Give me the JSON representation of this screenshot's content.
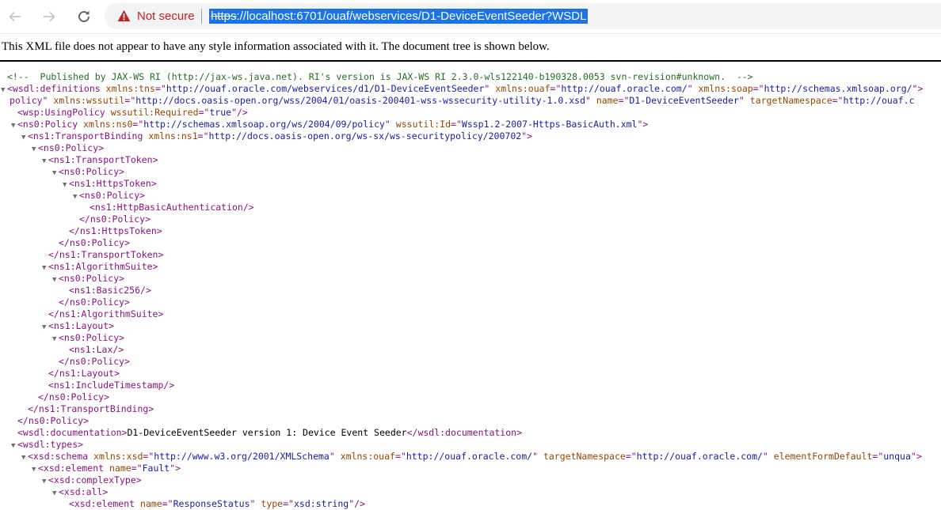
{
  "browser": {
    "security_label": "Not secure",
    "url_scheme": "https",
    "url_rest": "://localhost:6701/ouaf/webservices/D1-DeviceEventSeeder?WSDL",
    "icons": {
      "back": "arrow-left-icon",
      "forward": "arrow-right-icon",
      "reload": "reload-icon",
      "warning": "warning-triangle-icon"
    },
    "colors": {
      "warning": "#c5221f",
      "selection": "#1a73e8"
    }
  },
  "notice": "This XML file does not appear to have any style information associated with it. The document tree is shown below.",
  "xml_lines": [
    {
      "indent": 0,
      "toggle": "",
      "kind": "comment",
      "text": "<!--  Published by JAX-WS RI (http://jax-ws.java.net). RI's version is JAX-WS RI 2.3.0-wls122140-b190328.0053 svn-revision#unknown.  -->"
    },
    {
      "indent": 0,
      "toggle": "▼",
      "kind": "open",
      "tag": "wsdl:definitions",
      "attrs": [
        [
          "xmlns:tns",
          "http://ouaf.oracle.com/webservices/d1/D1-DeviceEventSeeder"
        ],
        [
          "xmlns:ouaf",
          "http://ouaf.oracle.com/"
        ],
        [
          "xmlns:soap",
          "http://schemas.xmlsoap.org/"
        ]
      ]
    },
    {
      "indent": 0,
      "toggle": "",
      "kind": "wrap",
      "parts": [
        [
          "txt",
          "policy\" "
        ],
        [
          "an",
          "xmlns:wssutil"
        ],
        [
          "txt",
          "=\""
        ],
        [
          "av",
          "http://docs.oasis-open.org/wss/2004/01/oasis-200401-wss-wssecurity-utility-1.0.xsd"
        ],
        [
          "txt",
          "\" "
        ],
        [
          "an",
          "name"
        ],
        [
          "txt",
          "=\""
        ],
        [
          "av",
          "D1-DeviceEventSeeder"
        ],
        [
          "txt",
          "\" "
        ],
        [
          "an",
          "targetNamespace"
        ],
        [
          "txt",
          "=\""
        ],
        [
          "av",
          "http://ouaf.c"
        ]
      ]
    },
    {
      "indent": 1,
      "toggle": "",
      "kind": "self",
      "tag": "wsp:UsingPolicy",
      "attrs": [
        [
          "wssutil:Required",
          "true"
        ]
      ]
    },
    {
      "indent": 1,
      "toggle": "▼",
      "kind": "open",
      "tag": "ns0:Policy",
      "attrs": [
        [
          "xmlns:ns0",
          "http://schemas.xmlsoap.org/ws/2004/09/policy"
        ],
        [
          "wssutil:Id",
          "Wssp1.2-2007-Https-BasicAuth.xml"
        ]
      ]
    },
    {
      "indent": 2,
      "toggle": "▼",
      "kind": "open",
      "tag": "ns1:TransportBinding",
      "attrs": [
        [
          "xmlns:ns1",
          "http://docs.oasis-open.org/ws-sx/ws-securitypolicy/200702"
        ]
      ]
    },
    {
      "indent": 3,
      "toggle": "▼",
      "kind": "open",
      "tag": "ns0:Policy",
      "attrs": []
    },
    {
      "indent": 4,
      "toggle": "▼",
      "kind": "open",
      "tag": "ns1:TransportToken",
      "attrs": []
    },
    {
      "indent": 5,
      "toggle": "▼",
      "kind": "open",
      "tag": "ns0:Policy",
      "attrs": []
    },
    {
      "indent": 6,
      "toggle": "▼",
      "kind": "open",
      "tag": "ns1:HttpsToken",
      "attrs": []
    },
    {
      "indent": 7,
      "toggle": "▼",
      "kind": "open",
      "tag": "ns0:Policy",
      "attrs": []
    },
    {
      "indent": 8,
      "toggle": "",
      "kind": "self",
      "tag": "ns1:HttpBasicAuthentication",
      "attrs": []
    },
    {
      "indent": 7,
      "toggle": "",
      "kind": "close",
      "tag": "ns0:Policy"
    },
    {
      "indent": 6,
      "toggle": "",
      "kind": "close",
      "tag": "ns1:HttpsToken"
    },
    {
      "indent": 5,
      "toggle": "",
      "kind": "close",
      "tag": "ns0:Policy"
    },
    {
      "indent": 4,
      "toggle": "",
      "kind": "close",
      "tag": "ns1:TransportToken"
    },
    {
      "indent": 4,
      "toggle": "▼",
      "kind": "open",
      "tag": "ns1:AlgorithmSuite",
      "attrs": []
    },
    {
      "indent": 5,
      "toggle": "▼",
      "kind": "open",
      "tag": "ns0:Policy",
      "attrs": []
    },
    {
      "indent": 6,
      "toggle": "",
      "kind": "self",
      "tag": "ns1:Basic256",
      "attrs": []
    },
    {
      "indent": 5,
      "toggle": "",
      "kind": "close",
      "tag": "ns0:Policy"
    },
    {
      "indent": 4,
      "toggle": "",
      "kind": "close",
      "tag": "ns1:AlgorithmSuite"
    },
    {
      "indent": 4,
      "toggle": "▼",
      "kind": "open",
      "tag": "ns1:Layout",
      "attrs": []
    },
    {
      "indent": 5,
      "toggle": "▼",
      "kind": "open",
      "tag": "ns0:Policy",
      "attrs": []
    },
    {
      "indent": 6,
      "toggle": "",
      "kind": "self",
      "tag": "ns1:Lax",
      "attrs": []
    },
    {
      "indent": 5,
      "toggle": "",
      "kind": "close",
      "tag": "ns0:Policy"
    },
    {
      "indent": 4,
      "toggle": "",
      "kind": "close",
      "tag": "ns1:Layout"
    },
    {
      "indent": 4,
      "toggle": "",
      "kind": "self",
      "tag": "ns1:IncludeTimestamp",
      "attrs": []
    },
    {
      "indent": 3,
      "toggle": "",
      "kind": "close",
      "tag": "ns0:Policy"
    },
    {
      "indent": 2,
      "toggle": "",
      "kind": "close",
      "tag": "ns1:TransportBinding"
    },
    {
      "indent": 1,
      "toggle": "",
      "kind": "close",
      "tag": "ns0:Policy"
    },
    {
      "indent": 1,
      "toggle": "",
      "kind": "textnode",
      "tag": "wsdl:documentation",
      "text": "D1-DeviceEventSeeder version 1: Device Event Seeder"
    },
    {
      "indent": 1,
      "toggle": "▼",
      "kind": "open",
      "tag": "wsdl:types",
      "attrs": []
    },
    {
      "indent": 2,
      "toggle": "▼",
      "kind": "open",
      "tag": "xsd:schema",
      "attrs": [
        [
          "xmlns:xsd",
          "http://www.w3.org/2001/XMLSchema"
        ],
        [
          "xmlns:ouaf",
          "http://ouaf.oracle.com/"
        ],
        [
          "targetNamespace",
          "http://ouaf.oracle.com/"
        ],
        [
          "elementFormDefault",
          "unqua"
        ]
      ]
    },
    {
      "indent": 3,
      "toggle": "▼",
      "kind": "open",
      "tag": "xsd:element",
      "attrs": [
        [
          "name",
          "Fault"
        ]
      ]
    },
    {
      "indent": 4,
      "toggle": "▼",
      "kind": "open",
      "tag": "xsd:complexType",
      "attrs": []
    },
    {
      "indent": 5,
      "toggle": "▼",
      "kind": "open",
      "tag": "xsd:all",
      "attrs": []
    },
    {
      "indent": 6,
      "toggle": "",
      "kind": "self",
      "tag": "xsd:element",
      "attrs": [
        [
          "name",
          "ResponseStatus"
        ],
        [
          "type",
          "xsd:string"
        ]
      ]
    }
  ]
}
